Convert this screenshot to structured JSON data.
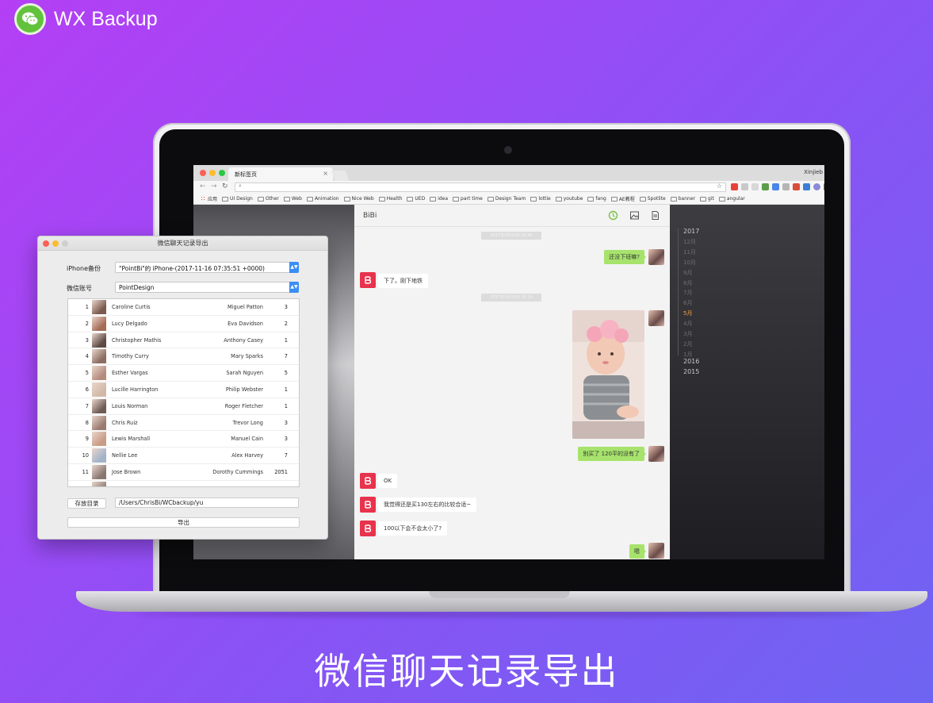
{
  "brand": {
    "name": "WX Backup"
  },
  "browser": {
    "tab_title": "新标签页",
    "tab_close": "×",
    "user": "Xinjieb",
    "url_search_glyph": "⌕",
    "bookmarks": [
      "应用",
      "UI Design",
      "Other",
      "Web",
      "Animation",
      "Nice Web",
      "Health",
      "UED",
      "idea",
      "part time",
      "Design Team",
      "lottie",
      "youtube",
      "fang",
      "AE教程",
      "Spotlite",
      "banner",
      "git",
      "angular"
    ]
  },
  "chat": {
    "title": "BiBi",
    "timestamps": [
      "2017年5月20日 20:46",
      "2017年5月20日 19:14"
    ],
    "messages": [
      {
        "side": "right",
        "text": "还没下班嘛?"
      },
      {
        "side": "left",
        "text": "下了。刚下地铁"
      },
      {
        "side": "right",
        "type": "photo",
        "text": ""
      },
      {
        "side": "right",
        "text": "别买了 120平的没有了"
      },
      {
        "side": "left",
        "text": "OK"
      },
      {
        "side": "left",
        "text": "我觉得还是买130左右的比较合适~"
      },
      {
        "side": "left",
        "text": "100以下会不会太小了?"
      },
      {
        "side": "right",
        "text": "嗯"
      }
    ]
  },
  "timeline": {
    "entries": [
      {
        "label": "2017",
        "kind": "year"
      },
      {
        "label": "12月",
        "kind": "month"
      },
      {
        "label": "11月",
        "kind": "month"
      },
      {
        "label": "10月",
        "kind": "month"
      },
      {
        "label": "9月",
        "kind": "month"
      },
      {
        "label": "8月",
        "kind": "month"
      },
      {
        "label": "7月",
        "kind": "month"
      },
      {
        "label": "6月",
        "kind": "month"
      },
      {
        "label": "5月",
        "kind": "active"
      },
      {
        "label": "4月",
        "kind": "month"
      },
      {
        "label": "3月",
        "kind": "month"
      },
      {
        "label": "2月",
        "kind": "month"
      },
      {
        "label": "1月",
        "kind": "month"
      },
      {
        "label": "2016",
        "kind": "year"
      },
      {
        "label": "2015",
        "kind": "year"
      }
    ]
  },
  "dialog": {
    "title": "微信聊天记录导出",
    "iphone_label": "iPhone备份",
    "iphone_value": "\"PointBi\"的 iPhone-(2017-11-16 07:35:51 +0000)",
    "account_label": "微信账号",
    "account_value": "PointDesign",
    "save_dir_button": "存放目录",
    "save_path": "/Users/ChrisBi/WCbackup/yu",
    "export_button": "导出",
    "rows": [
      {
        "idx": "1",
        "name": "Caroline Curtis",
        "nick": "Miguel Patton",
        "count": "3"
      },
      {
        "idx": "2",
        "name": "Lucy Delgado",
        "nick": "Eva Davidson",
        "count": "2"
      },
      {
        "idx": "3",
        "name": "Christopher Mathis",
        "nick": "Anthony Casey",
        "count": "1"
      },
      {
        "idx": "4",
        "name": "Timothy Curry",
        "nick": "Mary Sparks",
        "count": "7"
      },
      {
        "idx": "5",
        "name": "Esther Vargas",
        "nick": "Sarah Nguyen",
        "count": "5"
      },
      {
        "idx": "6",
        "name": "Lucille Harrington",
        "nick": "Philip Webster",
        "count": "1"
      },
      {
        "idx": "7",
        "name": "Louis Norman",
        "nick": "Roger Fletcher",
        "count": "1"
      },
      {
        "idx": "8",
        "name": "Chris Ruiz",
        "nick": "Trevor Long",
        "count": "3"
      },
      {
        "idx": "9",
        "name": "Lewis Marshall",
        "nick": "Manuel Cain",
        "count": "3"
      },
      {
        "idx": "10",
        "name": "Nellie Lee",
        "nick": "Alex Harvey",
        "count": "7"
      },
      {
        "idx": "11",
        "name": "Jose Brown",
        "nick": "Dorothy Cummings",
        "count": "2051"
      }
    ]
  },
  "caption": "微信聊天记录导出",
  "colors": {
    "accent_blue": "#3a8ef6",
    "wechat_green": "#62c23c",
    "bubble_green": "#a7e36c",
    "bibi_red": "#e8334d",
    "timeline_active": "#f2a23a"
  },
  "icons": {
    "brand": "wechat-icon",
    "chat_header": [
      "history-icon",
      "image-icon",
      "document-icon"
    ],
    "select": "chevron-updown-icon"
  }
}
